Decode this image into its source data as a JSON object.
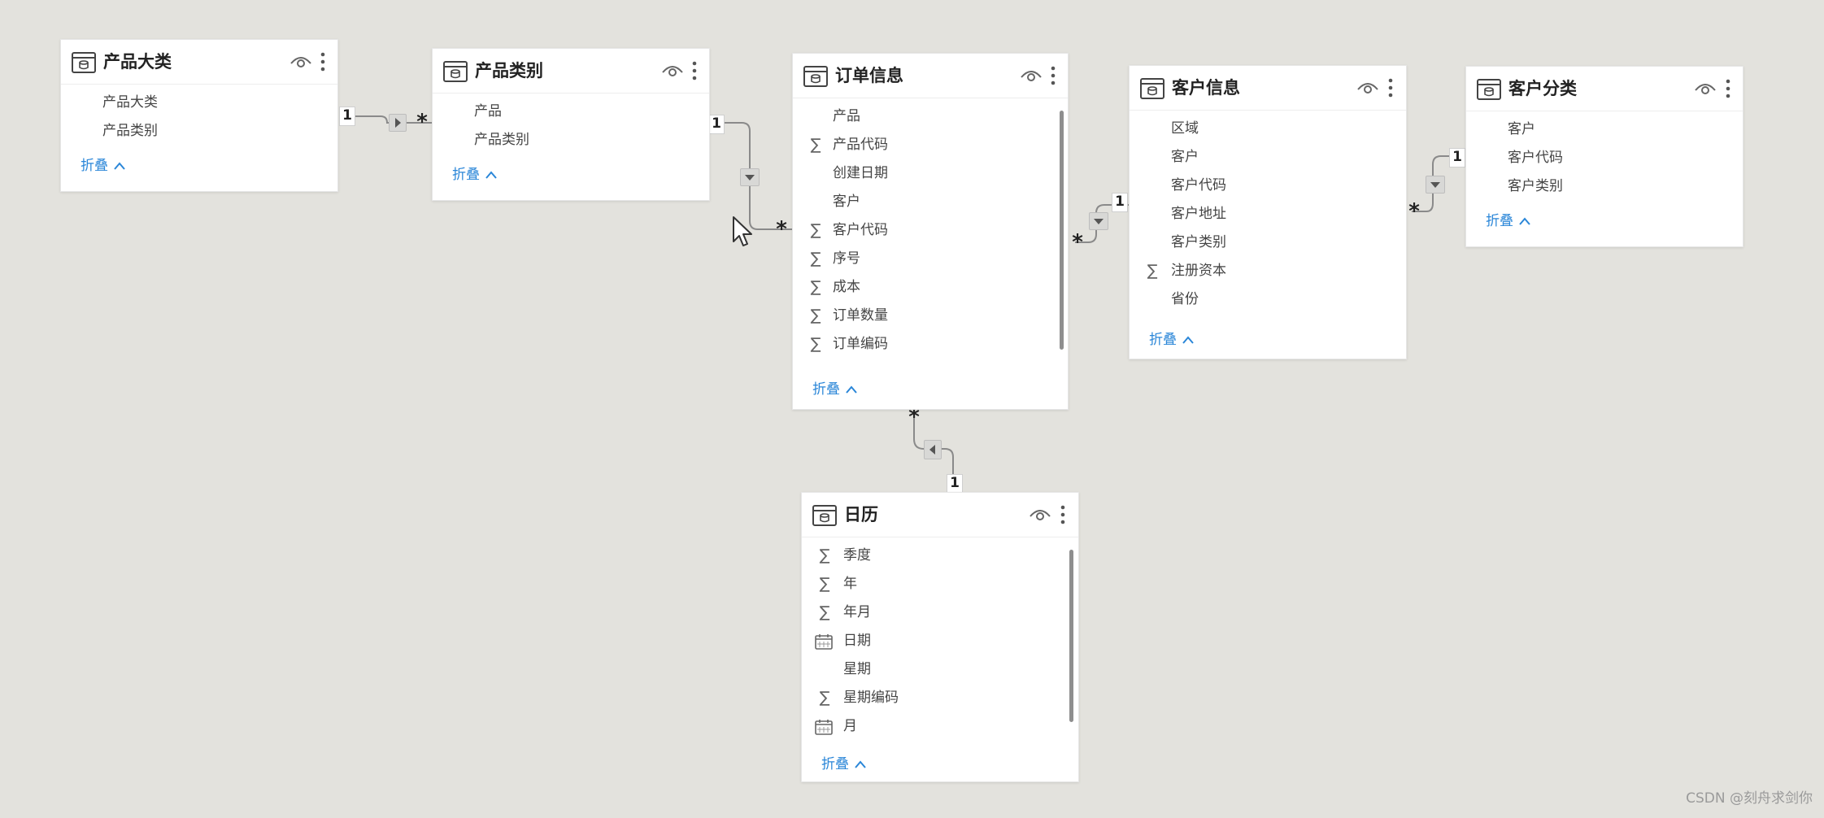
{
  "tables": {
    "product_category_major": {
      "title": "产品大类",
      "fields": [
        "产品大类",
        "产品类别"
      ],
      "collapse": "折叠"
    },
    "product_category": {
      "title": "产品类别",
      "fields": [
        "产品",
        "产品类别"
      ],
      "collapse": "折叠"
    },
    "order_info": {
      "title": "订单信息",
      "fields": [
        "产品",
        "产品代码",
        "创建日期",
        "客户",
        "客户代码",
        "序号",
        "成本",
        "订单数量",
        "订单编码"
      ],
      "collapse": "折叠"
    },
    "customer_info": {
      "title": "客户信息",
      "fields": [
        "区域",
        "客户",
        "客户代码",
        "客户地址",
        "客户类别",
        "注册资本",
        "省份"
      ],
      "collapse": "折叠"
    },
    "customer_class": {
      "title": "客户分类",
      "fields": [
        "客户",
        "客户代码",
        "客户类别"
      ],
      "collapse": "折叠"
    },
    "calendar": {
      "title": "日历",
      "fields": [
        "季度",
        "年",
        "年月",
        "日期",
        "星期",
        "星期编码",
        "月"
      ],
      "collapse": "折叠"
    }
  },
  "field_icons": {
    "order_info": [
      "none",
      "sigma",
      "none",
      "none",
      "sigma",
      "sigma",
      "sigma",
      "sigma",
      "sigma"
    ],
    "customer_info": [
      "none",
      "none",
      "none",
      "none",
      "none",
      "sigma",
      "none"
    ],
    "calendar": [
      "sigma",
      "sigma",
      "sigma",
      "calendar",
      "none",
      "sigma",
      "calendar"
    ]
  },
  "relationships": {
    "r1": {
      "one": "1",
      "many": "*"
    },
    "r2": {
      "one": "1",
      "many": "*"
    },
    "r3": {
      "one": "1",
      "many": "*"
    },
    "r4": {
      "one": "1",
      "many": "*"
    },
    "r5": {
      "one": "1",
      "many": "*"
    }
  },
  "symbols": {
    "sigma": "∑"
  },
  "colors": {
    "canvas": "#e3e2dd",
    "card": "#ffffff",
    "link": "#2a86d8",
    "line": "#8a8a8a"
  },
  "watermark": "CSDN @刻舟求剑你"
}
